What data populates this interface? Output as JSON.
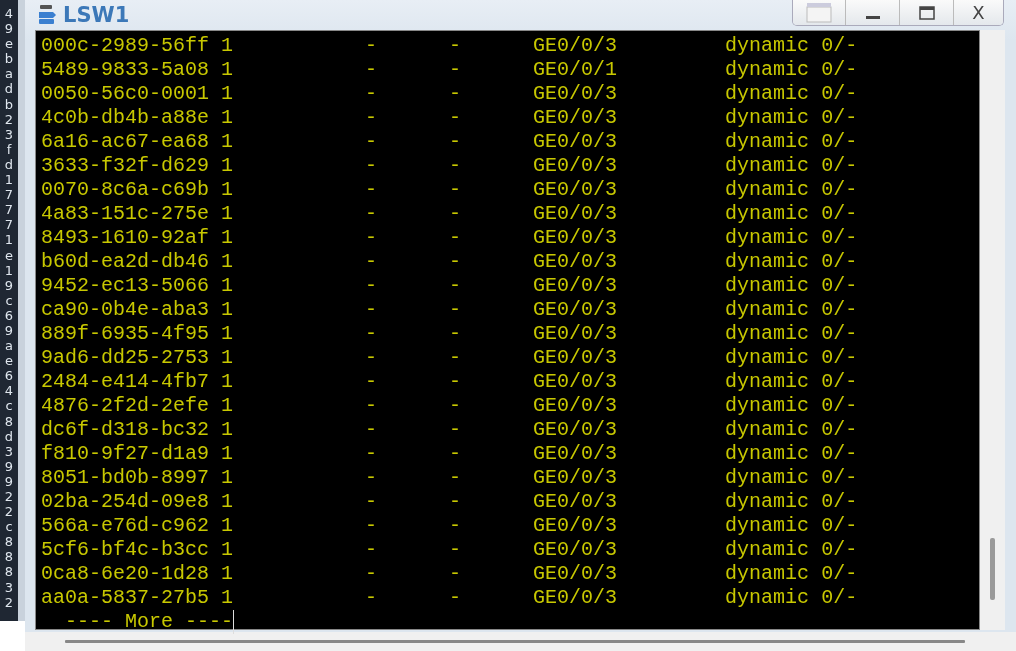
{
  "background_window": {
    "characters": [
      "4",
      "9",
      "e",
      "b",
      "a",
      "d",
      "b",
      "2",
      "3",
      "f",
      "d",
      "1",
      "7",
      "7",
      "7",
      "1",
      "e",
      "1",
      "9",
      "c",
      "6",
      "9",
      "a",
      "e",
      "6",
      "4",
      "c",
      "8",
      "d",
      "3",
      "9",
      "9",
      "2",
      "2",
      "c",
      "8",
      "8",
      "8",
      "3",
      "2"
    ]
  },
  "window": {
    "title": "LSW1",
    "buttons": [
      {
        "kind": "app"
      },
      {
        "kind": "minimize"
      },
      {
        "kind": "maximize"
      },
      {
        "kind": "close",
        "label": "X"
      }
    ]
  },
  "terminal": {
    "rows": [
      [
        "000c-2989-56ff",
        "1",
        "-",
        "-",
        "GE0/0/3",
        "dynamic",
        "0/-"
      ],
      [
        "5489-9833-5a08",
        "1",
        "-",
        "-",
        "GE0/0/1",
        "dynamic",
        "0/-"
      ],
      [
        "0050-56c0-0001",
        "1",
        "-",
        "-",
        "GE0/0/3",
        "dynamic",
        "0/-"
      ],
      [
        "4c0b-db4b-a88e",
        "1",
        "-",
        "-",
        "GE0/0/3",
        "dynamic",
        "0/-"
      ],
      [
        "6a16-ac67-ea68",
        "1",
        "-",
        "-",
        "GE0/0/3",
        "dynamic",
        "0/-"
      ],
      [
        "3633-f32f-d629",
        "1",
        "-",
        "-",
        "GE0/0/3",
        "dynamic",
        "0/-"
      ],
      [
        "0070-8c6a-c69b",
        "1",
        "-",
        "-",
        "GE0/0/3",
        "dynamic",
        "0/-"
      ],
      [
        "4a83-151c-275e",
        "1",
        "-",
        "-",
        "GE0/0/3",
        "dynamic",
        "0/-"
      ],
      [
        "8493-1610-92af",
        "1",
        "-",
        "-",
        "GE0/0/3",
        "dynamic",
        "0/-"
      ],
      [
        "b60d-ea2d-db46",
        "1",
        "-",
        "-",
        "GE0/0/3",
        "dynamic",
        "0/-"
      ],
      [
        "9452-ec13-5066",
        "1",
        "-",
        "-",
        "GE0/0/3",
        "dynamic",
        "0/-"
      ],
      [
        "ca90-0b4e-aba3",
        "1",
        "-",
        "-",
        "GE0/0/3",
        "dynamic",
        "0/-"
      ],
      [
        "889f-6935-4f95",
        "1",
        "-",
        "-",
        "GE0/0/3",
        "dynamic",
        "0/-"
      ],
      [
        "9ad6-dd25-2753",
        "1",
        "-",
        "-",
        "GE0/0/3",
        "dynamic",
        "0/-"
      ],
      [
        "2484-e414-4fb7",
        "1",
        "-",
        "-",
        "GE0/0/3",
        "dynamic",
        "0/-"
      ],
      [
        "4876-2f2d-2efe",
        "1",
        "-",
        "-",
        "GE0/0/3",
        "dynamic",
        "0/-"
      ],
      [
        "dc6f-d318-bc32",
        "1",
        "-",
        "-",
        "GE0/0/3",
        "dynamic",
        "0/-"
      ],
      [
        "f810-9f27-d1a9",
        "1",
        "-",
        "-",
        "GE0/0/3",
        "dynamic",
        "0/-"
      ],
      [
        "8051-bd0b-8997",
        "1",
        "-",
        "-",
        "GE0/0/3",
        "dynamic",
        "0/-"
      ],
      [
        "02ba-254d-09e8",
        "1",
        "-",
        "-",
        "GE0/0/3",
        "dynamic",
        "0/-"
      ],
      [
        "566a-e76d-c962",
        "1",
        "-",
        "-",
        "GE0/0/3",
        "dynamic",
        "0/-"
      ],
      [
        "5cf6-bf4c-b3cc",
        "1",
        "-",
        "-",
        "GE0/0/3",
        "dynamic",
        "0/-"
      ],
      [
        "0ca8-6e20-1d28",
        "1",
        "-",
        "-",
        "GE0/0/3",
        "dynamic",
        "0/-"
      ],
      [
        "aa0a-5837-27b5",
        "1",
        "-",
        "-",
        "GE0/0/3",
        "dynamic",
        "0/-"
      ]
    ],
    "more_prompt": "---- More ----"
  }
}
